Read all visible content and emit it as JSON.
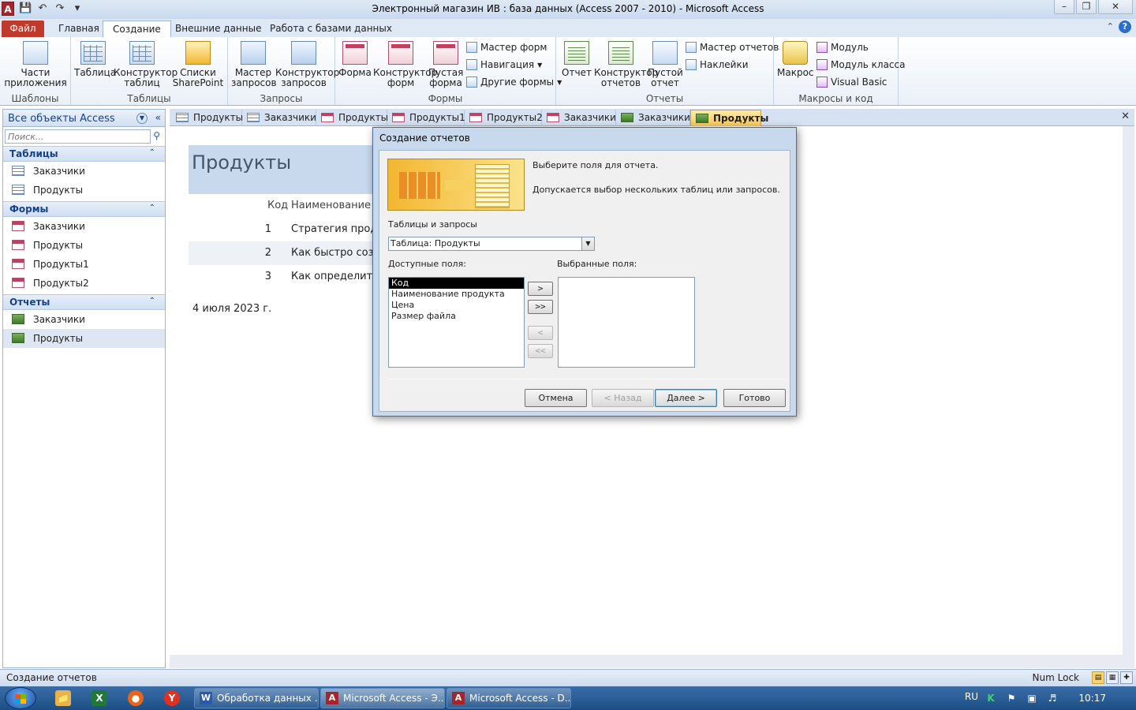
{
  "window": {
    "title": "Электронный магазин ИВ : база данных (Access 2007 - 2010)  -  Microsoft Access",
    "app_icon": "A"
  },
  "ribbon": {
    "tabs": [
      {
        "label": "Файл"
      },
      {
        "label": "Главная"
      },
      {
        "label": "Создание"
      },
      {
        "label": "Внешние данные"
      },
      {
        "label": "Работа с базами данных"
      }
    ],
    "active_tab": "Создание",
    "groups": {
      "templates": {
        "label": "Шаблоны",
        "buttons": {
          "app_parts": "Части\nприложения"
        }
      },
      "tables": {
        "label": "Таблицы",
        "buttons": {
          "table": "Таблица",
          "table_design": "Конструктор\nтаблиц",
          "sharepoint": "Списки\nSharePoint"
        }
      },
      "queries": {
        "label": "Запросы",
        "buttons": {
          "query_wizard": "Мастер\nзапросов",
          "query_design": "Конструктор\nзапросов"
        }
      },
      "forms": {
        "label": "Формы",
        "buttons": {
          "form": "Форма",
          "form_design": "Конструктор\nформ",
          "blank_form": "Пустая\nформа",
          "form_wizard": "Мастер форм",
          "navigation": "Навигация",
          "more_forms": "Другие формы"
        }
      },
      "reports": {
        "label": "Отчеты",
        "buttons": {
          "report": "Отчет",
          "report_design": "Конструктор\nотчетов",
          "blank_report": "Пустой\nотчет",
          "report_wizard": "Мастер отчетов",
          "labels": "Наклейки"
        }
      },
      "macros": {
        "label": "Макросы и код",
        "buttons": {
          "macro": "Макрос",
          "module": "Модуль",
          "class_module": "Модуль класса",
          "visual_basic": "Visual Basic"
        }
      }
    }
  },
  "nav": {
    "title": "Все объекты Access",
    "search_placeholder": "Поиск...",
    "sections": [
      {
        "title": "Таблицы",
        "items": [
          "Заказчики",
          "Продукты"
        ]
      },
      {
        "title": "Формы",
        "items": [
          "Заказчики",
          "Продукты",
          "Продукты1",
          "Продукты2"
        ]
      },
      {
        "title": "Отчеты",
        "items": [
          "Заказчики",
          "Продукты"
        ]
      }
    ]
  },
  "doc_tabs": [
    "Продукты",
    "Заказчики",
    "Продукты",
    "Продукты1",
    "Продукты2",
    "Заказчики",
    "Заказчики",
    "Продукты"
  ],
  "report": {
    "title": "Продукты",
    "col_code": "Код",
    "col_name": "Наименование п",
    "rows": [
      {
        "n": "1",
        "v": "Стратегия прода"
      },
      {
        "n": "2",
        "v": "Как быстро созд"
      },
      {
        "n": "3",
        "v": "Как определить"
      }
    ],
    "date": "4 июля 2023 г."
  },
  "dialog": {
    "title": "Создание отчетов",
    "text1": "Выберите поля для отчета.",
    "text2": "Допускается выбор нескольких таблиц или запросов.",
    "tables_label": "Таблицы и запросы",
    "tables_value": "Таблица: Продукты",
    "available_label": "Доступные поля:",
    "selected_label": "Выбранные поля:",
    "available_fields": [
      "Код",
      "Наименование продукта",
      "Цена",
      "Размер файла"
    ],
    "move_buttons": [
      ">",
      ">>",
      "<",
      "<<"
    ],
    "buttons": {
      "cancel": "Отмена",
      "back": "< Назад",
      "next": "Далее >",
      "finish": "Готово"
    }
  },
  "status": {
    "text": "Создание отчетов",
    "numlock": "Num Lock"
  },
  "taskbar": {
    "tasks": [
      {
        "label": "Обработка данных ...",
        "icon": "W"
      },
      {
        "label": "Microsoft Access - Э...",
        "icon": "A"
      },
      {
        "label": "Microsoft Access - D...",
        "icon": "A"
      }
    ],
    "lang": "RU",
    "clock": "10:17"
  }
}
